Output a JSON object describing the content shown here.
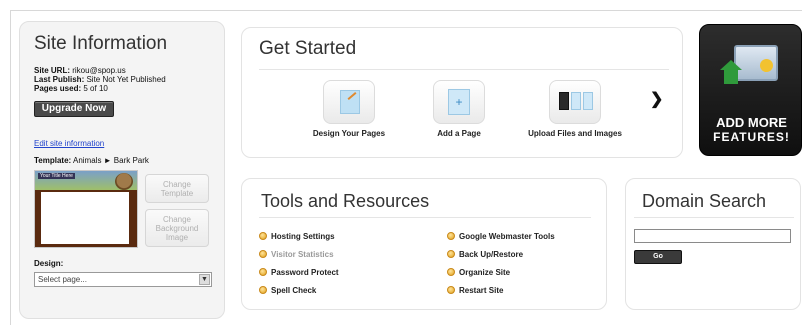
{
  "site_info": {
    "title": "Site Information",
    "site_url_label": "Site URL:",
    "site_url_value": "rikou@spop.us",
    "last_publish_label": "Last Publish:",
    "last_publish_value": "Site Not Yet Published",
    "pages_used_label": "Pages used:",
    "pages_used_value": "5 of 10",
    "upgrade_button": "Upgrade Now",
    "edit_link": "Edit site information",
    "template_label": "Template:",
    "template_value": "Animals ► Bark Park",
    "thumbnail_caption": "Your Title Here",
    "change_template": "Change Template",
    "change_background": "Change Background Image",
    "design_label": "Design:",
    "design_select_value": "Select page..."
  },
  "get_started": {
    "title": "Get Started",
    "items": [
      {
        "label": "Design Your Pages",
        "icon": "design-pages-icon"
      },
      {
        "label": "Add a Page",
        "icon": "add-page-icon"
      },
      {
        "label": "Upload Files and Images",
        "icon": "upload-files-icon"
      }
    ],
    "next_icon": "chevron-right-icon"
  },
  "promo": {
    "line1": "ADD MORE",
    "line2": "FEATURES!"
  },
  "tools": {
    "title": "Tools and Resources",
    "left": [
      "Hosting Settings",
      "Visitor Statistics",
      "Password Protect",
      "Spell Check"
    ],
    "right": [
      "Google Webmaster Tools",
      "Back Up/Restore",
      "Organize Site",
      "Restart Site"
    ]
  },
  "domain": {
    "title": "Domain Search",
    "input_value": "",
    "go_button": "Go"
  },
  "colors": {
    "bullet": "#e1a21b",
    "link": "#2244cc",
    "promo_bg": "#1a1a1a"
  }
}
